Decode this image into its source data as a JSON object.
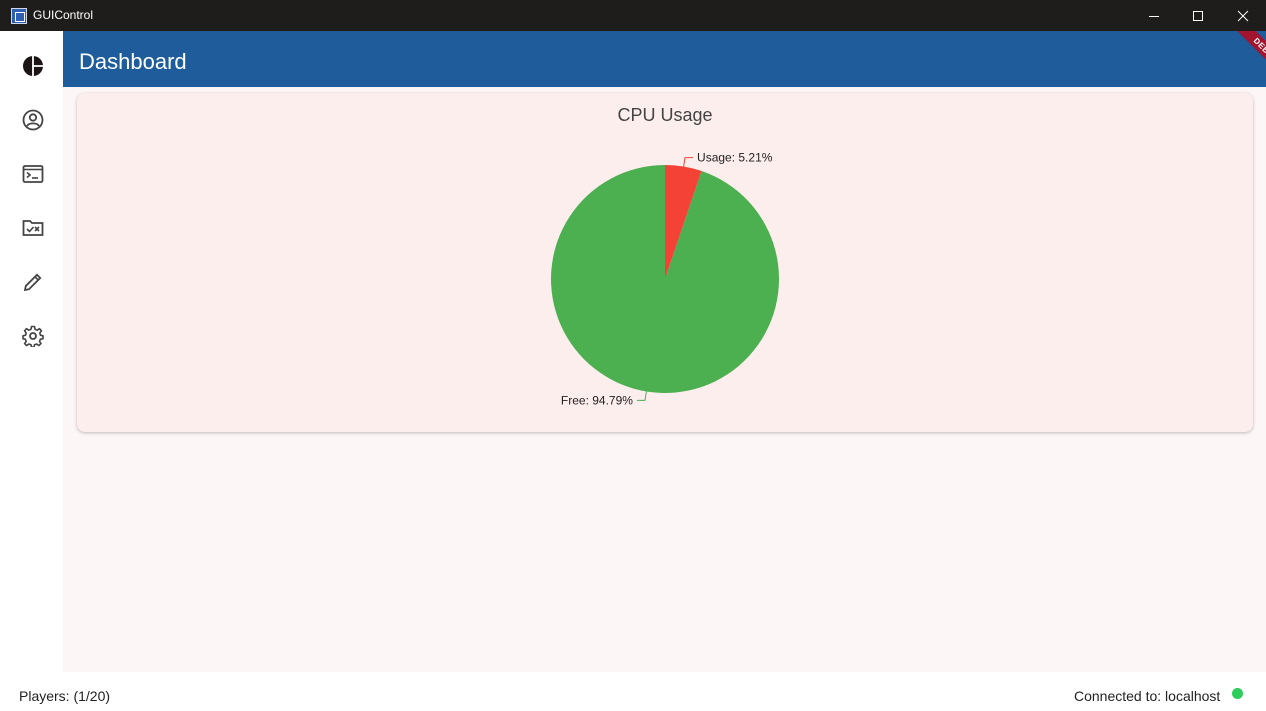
{
  "window": {
    "title": "GUIControl"
  },
  "titlebar_buttons": [
    {
      "name": "minimize-icon"
    },
    {
      "name": "maximize-icon"
    },
    {
      "name": "close-icon"
    }
  ],
  "sidebar": {
    "items": [
      {
        "icon": "pie-chart-icon",
        "selected": true
      },
      {
        "icon": "account-circle-icon"
      },
      {
        "icon": "terminal-icon"
      },
      {
        "icon": "folder-check-icon"
      },
      {
        "icon": "pencil-icon"
      },
      {
        "icon": "gear-icon"
      }
    ]
  },
  "header": {
    "title": "Dashboard",
    "debug_badge": "DEBUG",
    "color": "#1e5c9c"
  },
  "chart_data": {
    "type": "pie",
    "title": "CPU Usage",
    "slices": [
      {
        "label": "Usage",
        "value": 5.21,
        "display": "Usage: 5.21%",
        "color": "#f44336"
      },
      {
        "label": "Free",
        "value": 94.79,
        "display": "Free: 94.79%",
        "color": "#4caf50"
      }
    ]
  },
  "status": {
    "players": "Players: (1/20)",
    "connection": "Connected to: localhost",
    "connection_color": "#2ecc5b"
  }
}
